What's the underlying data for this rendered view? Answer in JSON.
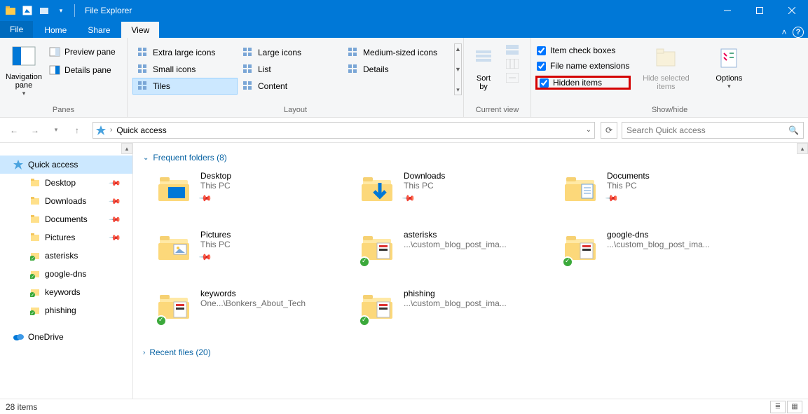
{
  "window": {
    "title": "File Explorer"
  },
  "tabs": {
    "file": "File",
    "home": "Home",
    "share": "Share",
    "view": "View"
  },
  "ribbon": {
    "panes": {
      "label": "Panes",
      "navigation": "Navigation\npane",
      "preview": "Preview pane",
      "details": "Details pane"
    },
    "layout": {
      "label": "Layout",
      "items": [
        "Extra large icons",
        "Large icons",
        "Medium-sized icons",
        "Small icons",
        "List",
        "Details",
        "Tiles",
        "Content"
      ]
    },
    "current_view": {
      "label": "Current view",
      "sort": "Sort\nby"
    },
    "show_hide": {
      "label": "Show/hide",
      "item_checkboxes": "Item check boxes",
      "file_ext": "File name extensions",
      "hidden": "Hidden items",
      "hide_selected": "Hide selected\nitems",
      "options": "Options"
    }
  },
  "breadcrumb": {
    "location": "Quick access"
  },
  "search": {
    "placeholder": "Search Quick access"
  },
  "tree": {
    "quick_access": "Quick access",
    "items": [
      {
        "label": "Desktop",
        "pinned": true
      },
      {
        "label": "Downloads",
        "pinned": true
      },
      {
        "label": "Documents",
        "pinned": true
      },
      {
        "label": "Pictures",
        "pinned": true
      },
      {
        "label": "asterisks",
        "pinned": false,
        "sync": true
      },
      {
        "label": "google-dns",
        "pinned": false,
        "sync": true
      },
      {
        "label": "keywords",
        "pinned": false,
        "sync": true
      },
      {
        "label": "phishing",
        "pinned": false,
        "sync": true
      }
    ],
    "onedrive": "OneDrive"
  },
  "sections": {
    "frequent": {
      "title": "Frequent folders (8)"
    },
    "recent": {
      "title": "Recent files (20)"
    }
  },
  "folders": [
    {
      "name": "Desktop",
      "sub": "This PC",
      "pinned": true,
      "overlay": "desktop"
    },
    {
      "name": "Downloads",
      "sub": "This PC",
      "pinned": true,
      "overlay": "download"
    },
    {
      "name": "Documents",
      "sub": "This PC",
      "pinned": true,
      "overlay": "document"
    },
    {
      "name": "Pictures",
      "sub": "This PC",
      "pinned": true,
      "overlay": "picture"
    },
    {
      "name": "asterisks",
      "sub": "...\\custom_blog_post_ima...",
      "sync": true,
      "overlay": "generic"
    },
    {
      "name": "google-dns",
      "sub": "...\\custom_blog_post_ima...",
      "sync": true,
      "overlay": "generic"
    },
    {
      "name": "keywords",
      "sub": "One...\\Bonkers_About_Tech",
      "sync": true,
      "overlay": "generic"
    },
    {
      "name": "phishing",
      "sub": "...\\custom_blog_post_ima...",
      "sync": true,
      "overlay": "generic"
    }
  ],
  "status": {
    "text": "28 items"
  }
}
